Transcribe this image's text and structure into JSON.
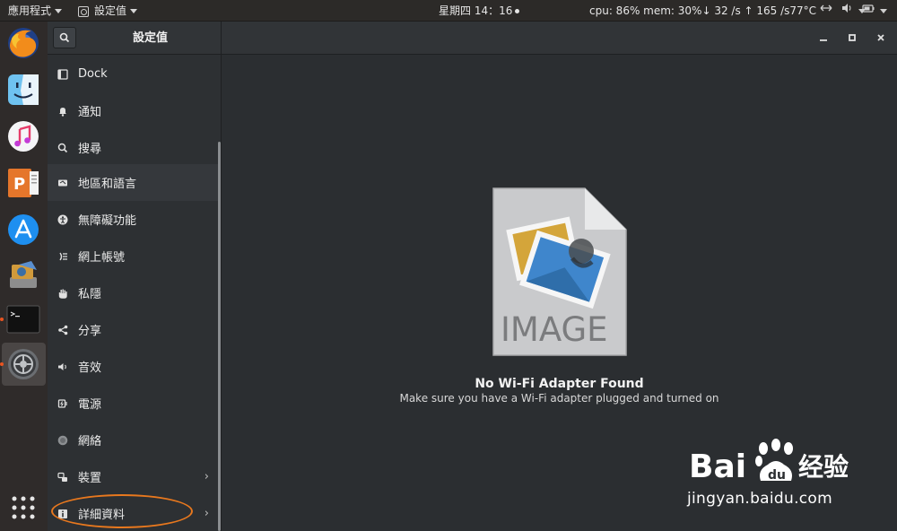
{
  "topbar": {
    "apps_menu": "應用程式",
    "active_app": "設定值",
    "clock": "星期四 14：16",
    "sysmon": "cpu: 86% mem: 30%↓  32  /s ↑ 165  /s77°C"
  },
  "dock": {
    "apps": [
      "firefox-icon",
      "finder-icon",
      "music-icon",
      "presentation-icon",
      "app-store-icon",
      "installer-icon",
      "terminal-icon",
      "settings-icon"
    ],
    "show_apps_icon": "grid-icon"
  },
  "header": {
    "title": "設定值",
    "window_controls": [
      "minimize-icon",
      "maximize-icon",
      "close-icon"
    ]
  },
  "sidebar": {
    "items": [
      {
        "label": "Dock",
        "icon": "dock-icon"
      },
      {
        "label": "通知",
        "icon": "bell-icon"
      },
      {
        "label": "搜尋",
        "icon": "search-icon"
      },
      {
        "label": "地區和語言",
        "icon": "flag-icon"
      },
      {
        "label": "無障礙功能",
        "icon": "accessibility-icon"
      },
      {
        "label": "網上帳號",
        "icon": "online-accounts-icon"
      },
      {
        "label": "私隱",
        "icon": "hand-icon"
      },
      {
        "label": "分享",
        "icon": "share-icon"
      },
      {
        "label": "音效",
        "icon": "speaker-icon"
      },
      {
        "label": "電源",
        "icon": "power-icon"
      },
      {
        "label": "網絡",
        "icon": "network-icon"
      },
      {
        "label": "裝置",
        "icon": "devices-icon"
      },
      {
        "label": "詳細資料",
        "icon": "info-icon"
      }
    ]
  },
  "main": {
    "placeholder_text": "IMAGE",
    "title": "No Wi-Fi Adapter Found",
    "subtitle": "Make sure you have a Wi-Fi adapter plugged and turned on"
  },
  "watermark": {
    "brand": "Bai",
    "brand2": "经验",
    "url": "jingyan.baidu.com"
  },
  "colors": {
    "accent": "#e95420",
    "annotation": "#e8781e",
    "panel_bg": "#2b2e31"
  }
}
